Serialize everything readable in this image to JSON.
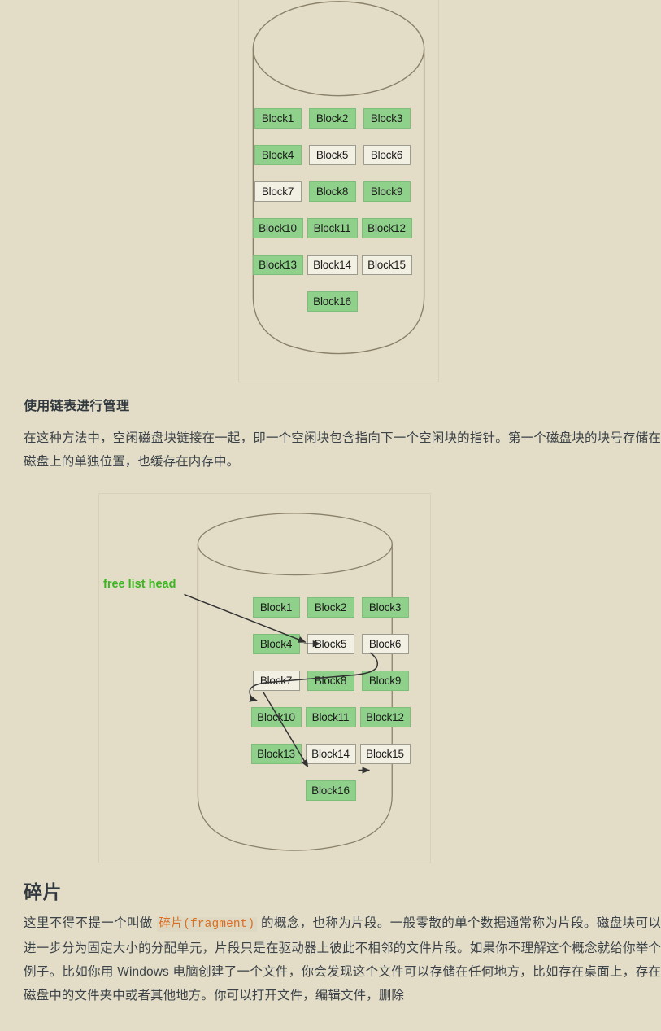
{
  "page": {
    "background_color": "#e3ddc8",
    "text_color": "#3b4248"
  },
  "diagram_free_list_bitmap": {
    "name": "disk-cylinder-block-map",
    "caption": "",
    "blocks": [
      {
        "label": "Block1",
        "state": "used"
      },
      {
        "label": "Block2",
        "state": "used"
      },
      {
        "label": "Block3",
        "state": "used"
      },
      {
        "label": "Block4",
        "state": "used"
      },
      {
        "label": "Block5",
        "state": "free"
      },
      {
        "label": "Block6",
        "state": "free"
      },
      {
        "label": "Block7",
        "state": "free"
      },
      {
        "label": "Block8",
        "state": "used"
      },
      {
        "label": "Block9",
        "state": "used"
      },
      {
        "label": "Block10",
        "state": "used"
      },
      {
        "label": "Block11",
        "state": "used"
      },
      {
        "label": "Block12",
        "state": "used"
      },
      {
        "label": "Block13",
        "state": "used"
      },
      {
        "label": "Block14",
        "state": "free"
      },
      {
        "label": "Block15",
        "state": "free"
      },
      {
        "label": "Block16",
        "state": "used"
      }
    ],
    "used_color": "#8fd18a",
    "free_color": "#f2efe3",
    "cylinder_stroke": "#8b8169"
  },
  "section_linked_list": {
    "heading": "使用链表进行管理",
    "paragraph": "在这种方法中，空闲磁盘块链接在一起，即一个空闲块包含指向下一个空闲块的指针。第一个磁盘块的块号存储在磁盘上的单独位置，也缓存在内存中。"
  },
  "diagram_linked_list": {
    "name": "disk-cylinder-free-list",
    "head_label": "free list head",
    "head_label_color": "#3cb521",
    "blocks": [
      {
        "label": "Block1",
        "state": "used"
      },
      {
        "label": "Block2",
        "state": "used"
      },
      {
        "label": "Block3",
        "state": "used"
      },
      {
        "label": "Block4",
        "state": "used"
      },
      {
        "label": "Block5",
        "state": "free"
      },
      {
        "label": "Block6",
        "state": "free"
      },
      {
        "label": "Block7",
        "state": "free"
      },
      {
        "label": "Block8",
        "state": "used"
      },
      {
        "label": "Block9",
        "state": "used"
      },
      {
        "label": "Block10",
        "state": "used"
      },
      {
        "label": "Block11",
        "state": "used"
      },
      {
        "label": "Block12",
        "state": "used"
      },
      {
        "label": "Block13",
        "state": "used"
      },
      {
        "label": "Block14",
        "state": "free"
      },
      {
        "label": "Block15",
        "state": "free"
      },
      {
        "label": "Block16",
        "state": "used"
      }
    ],
    "chain_order": [
      "Block5",
      "Block6",
      "Block7",
      "Block14",
      "Block15"
    ],
    "used_color": "#8fd18a",
    "free_color": "#f2efe3",
    "arrow_color": "#333333",
    "cylinder_stroke": "#8b8169"
  },
  "section_fragment": {
    "heading": "碎片",
    "paragraph_before_code": "这里不得不提一个叫做 ",
    "code": "碎片(fragment)",
    "paragraph_after_code": " 的概念，也称为片段。一般零散的单个数据通常称为片段。磁盘块可以进一步分为固定大小的分配单元，片段只是在驱动器上彼此不相邻的文件片段。如果你不理解这个概念就给你举个例子。比如你用 Windows 电脑创建了一个文件，你会发现这个文件可以存储在任何地方，比如存在桌面上，存在磁盘中的文件夹中或者其他地方。你可以打开文件，编辑文件，删除",
    "code_color": "#d96f24"
  }
}
